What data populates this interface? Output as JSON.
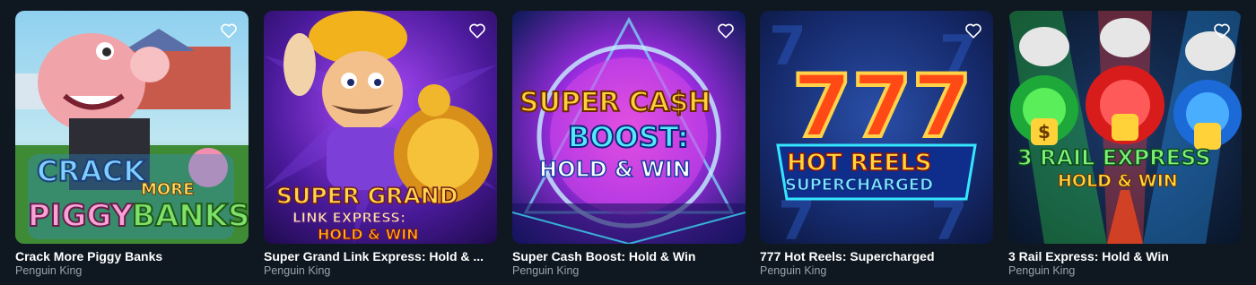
{
  "games": [
    {
      "title": "Crack More Piggy Banks",
      "provider": "Penguin King",
      "art_text": [
        "CRACK",
        "MORE",
        "PIGGY",
        "BANKS"
      ]
    },
    {
      "title": "Super Grand Link Express: Hold & ...",
      "provider": "Penguin King",
      "art_text": [
        "SUPER GRAND",
        "LINK EXPRESS:",
        "HOLD & WIN"
      ]
    },
    {
      "title": "Super Cash Boost: Hold & Win",
      "provider": "Penguin King",
      "art_text": [
        "SUPER CA$H",
        "BOOST:",
        "HOLD & WIN"
      ]
    },
    {
      "title": "777 Hot Reels: Supercharged",
      "provider": "Penguin King",
      "art_text": [
        "777",
        "HOT REELS",
        "SUPERCHARGED"
      ]
    },
    {
      "title": "3 Rail Express: Hold & Win",
      "provider": "Penguin King",
      "art_text": [
        "3 RAIL EXPRESS",
        "HOLD & WIN",
        "$"
      ]
    }
  ],
  "colors": {
    "page_bg": "#0f1720",
    "title": "#ffffff",
    "provider": "#9aa3ad"
  },
  "icons": {
    "favorite": "heart-outline-icon"
  }
}
